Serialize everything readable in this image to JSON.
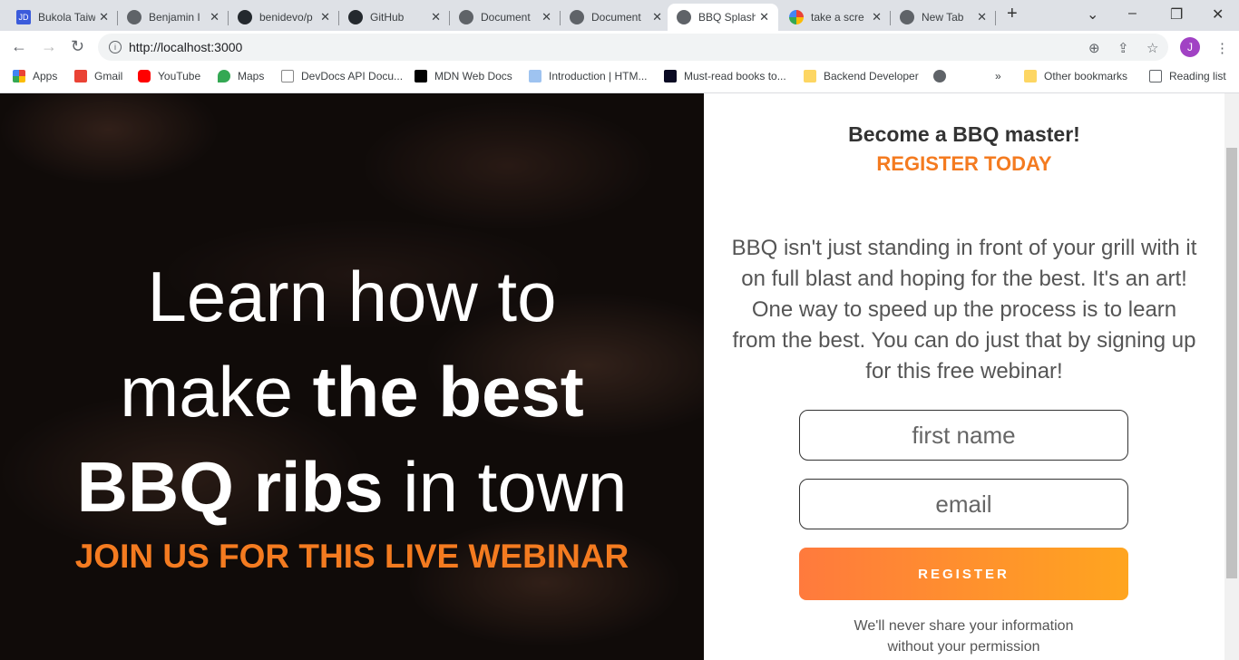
{
  "browser": {
    "tabs": [
      {
        "title": "Bukola Taiwo",
        "icon": "jd-icon",
        "active": false
      },
      {
        "title": "Benjamin I",
        "icon": "globe-icon",
        "active": false
      },
      {
        "title": "benidevo/p",
        "icon": "github-icon",
        "active": false
      },
      {
        "title": "GitHub",
        "icon": "github-icon",
        "active": false
      },
      {
        "title": "Document",
        "icon": "globe-icon",
        "active": false
      },
      {
        "title": "Document",
        "icon": "globe-icon",
        "active": false
      },
      {
        "title": "BBQ Splash",
        "icon": "globe-icon",
        "active": true
      },
      {
        "title": "take a scre",
        "icon": "google-icon",
        "active": false
      },
      {
        "title": "New Tab",
        "icon": "chrome-icon",
        "active": false
      }
    ],
    "url": "http://localhost:3000",
    "avatar_letter": "J",
    "bookmarks": [
      "Apps",
      "Gmail",
      "YouTube",
      "Maps",
      "DevDocs API Docu...",
      "MDN Web Docs",
      "Introduction | HTM...",
      "Must-read books to...",
      "Backend Developer"
    ],
    "other_bookmarks": "Other bookmarks",
    "reading_list": "Reading list"
  },
  "hero": {
    "line1": "Learn how to",
    "line2a": "make ",
    "line2b": "the best",
    "line3a": "BBQ ribs",
    "line3b": " in town",
    "subtitle": "JOIN US FOR THIS LIVE WEBINAR"
  },
  "form": {
    "title": "Become a BBQ master!",
    "subtitle": "REGISTER TODAY",
    "description": "BBQ isn't just standing in front of your grill with it on full blast and hoping for the best. It's an art! One way to speed up the process is to learn from the best. You can do just that by signing up for this free webinar!",
    "first_name_placeholder": "first name",
    "email_placeholder": "email",
    "register_label": "REGISTER",
    "privacy_note": "We'll never share your information without your permission"
  },
  "colors": {
    "accent": "#f47b20",
    "button_start": "#ff7a3d",
    "button_end": "#ffa51f"
  }
}
